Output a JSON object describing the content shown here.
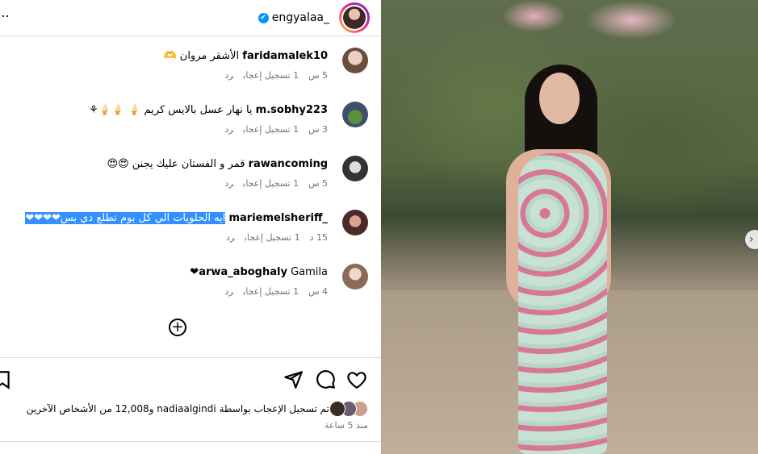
{
  "post": {
    "author": "engyalaa_",
    "more_icon": "⋯",
    "verified_icon": "✔"
  },
  "comments": [
    {
      "user": "faridamalek10",
      "text": "الأشقر مروان 🫶",
      "time": "5 س",
      "likes": "1 تسجيل إعجاب",
      "reply": "رد"
    },
    {
      "user": "m.sobhy223",
      "text": "يا نهار عسل بالايس كريم 🍦 🍦🍦⚘",
      "time": "3 س",
      "likes": "1 تسجيل إعجاب",
      "reply": "رد"
    },
    {
      "user": "rawancoming",
      "text": "قمر و الفستان عليك يجنن 😍😍",
      "time": "5 س",
      "likes": "1 تسجيل إعجاب",
      "reply": "رد"
    },
    {
      "user": "_mariemelsheriff",
      "text": "ايه الحلويات الي كل يوم تطلع دي بس❤❤❤❤",
      "time": "15 د",
      "likes": "1 تسجيل إعجاب",
      "reply": "رد"
    },
    {
      "user": "arwa_aboghaly",
      "text": "Gamila❤",
      "time": "4 س",
      "likes": "1 تسجيل إعجاب",
      "reply": "رد"
    }
  ],
  "add_comment_icon": "+",
  "likes_text": "تم تسجيل الإعجاب بواسطة nadiaalgindi و12,008 من الأشخاص الآخرين",
  "posted_time": "منذ 5 ساعة",
  "colors": {
    "verified": "#0095f6",
    "selection": "#3390ff",
    "meta": "#737373"
  },
  "next_icon": "›"
}
